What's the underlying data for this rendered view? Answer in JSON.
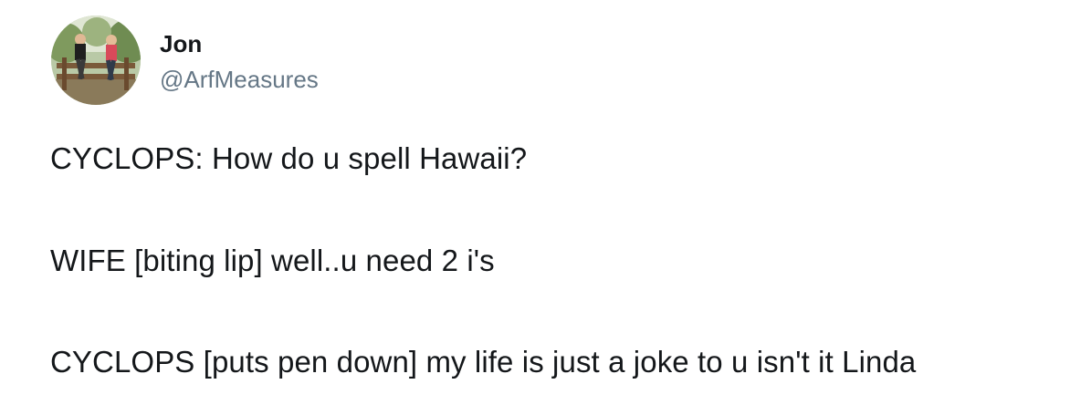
{
  "tweet": {
    "author": {
      "display_name": "Jon",
      "handle": "@ArfMeasures"
    },
    "lines": [
      "CYCLOPS: How do u spell Hawaii?",
      "WIFE [biting lip] well..u need 2 i's",
      "CYCLOPS [puts pen down] my life is just a joke to u isn't it Linda"
    ]
  }
}
